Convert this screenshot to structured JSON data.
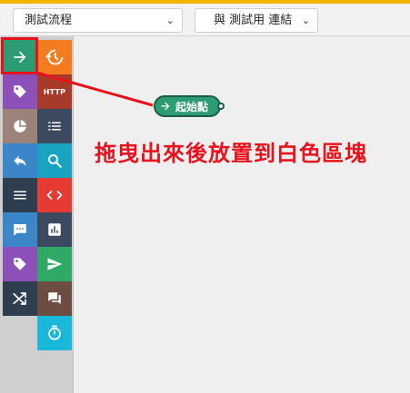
{
  "header": {
    "accent_color": "#f5b400",
    "flow_select": {
      "value": "測試流程"
    },
    "link_select": {
      "value": "與 測試用 連結"
    }
  },
  "palette": {
    "tiles": [
      {
        "name": "arrow-right-icon",
        "color": "#2e9c72"
      },
      {
        "name": "history-icon",
        "color": "#f47c20"
      },
      {
        "name": "tag-icon",
        "color": "#8d4fb8"
      },
      {
        "name": "http-icon",
        "color": "#a83a2a",
        "label": "HTTP"
      },
      {
        "name": "pie-chart-icon",
        "color": "#9c837a"
      },
      {
        "name": "list-icon",
        "color": "#3b4a5e"
      },
      {
        "name": "reply-icon",
        "color": "#3a86c8"
      },
      {
        "name": "search-icon",
        "color": "#19a3c3"
      },
      {
        "name": "menu-icon",
        "color": "#2f3d50"
      },
      {
        "name": "code-icon",
        "color": "#e53b33"
      },
      {
        "name": "chat-icon",
        "color": "#3a86c8"
      },
      {
        "name": "bar-chart-icon",
        "color": "#3b4a5e"
      },
      {
        "name": "tag-icon",
        "color": "#8d4fb8"
      },
      {
        "name": "send-icon",
        "color": "#2fa966"
      },
      {
        "name": "shuffle-icon",
        "color": "#2f3d50"
      },
      {
        "name": "forum-icon",
        "color": "#6d4c41"
      },
      {
        "name": "timer-icon",
        "color": "#19b8d8"
      }
    ]
  },
  "canvas": {
    "start_node": {
      "label": "起始點",
      "color": "#2e9c72"
    },
    "instruction": "拖曳出來後放置到白色區塊",
    "annotation_color": "#e8121d"
  }
}
